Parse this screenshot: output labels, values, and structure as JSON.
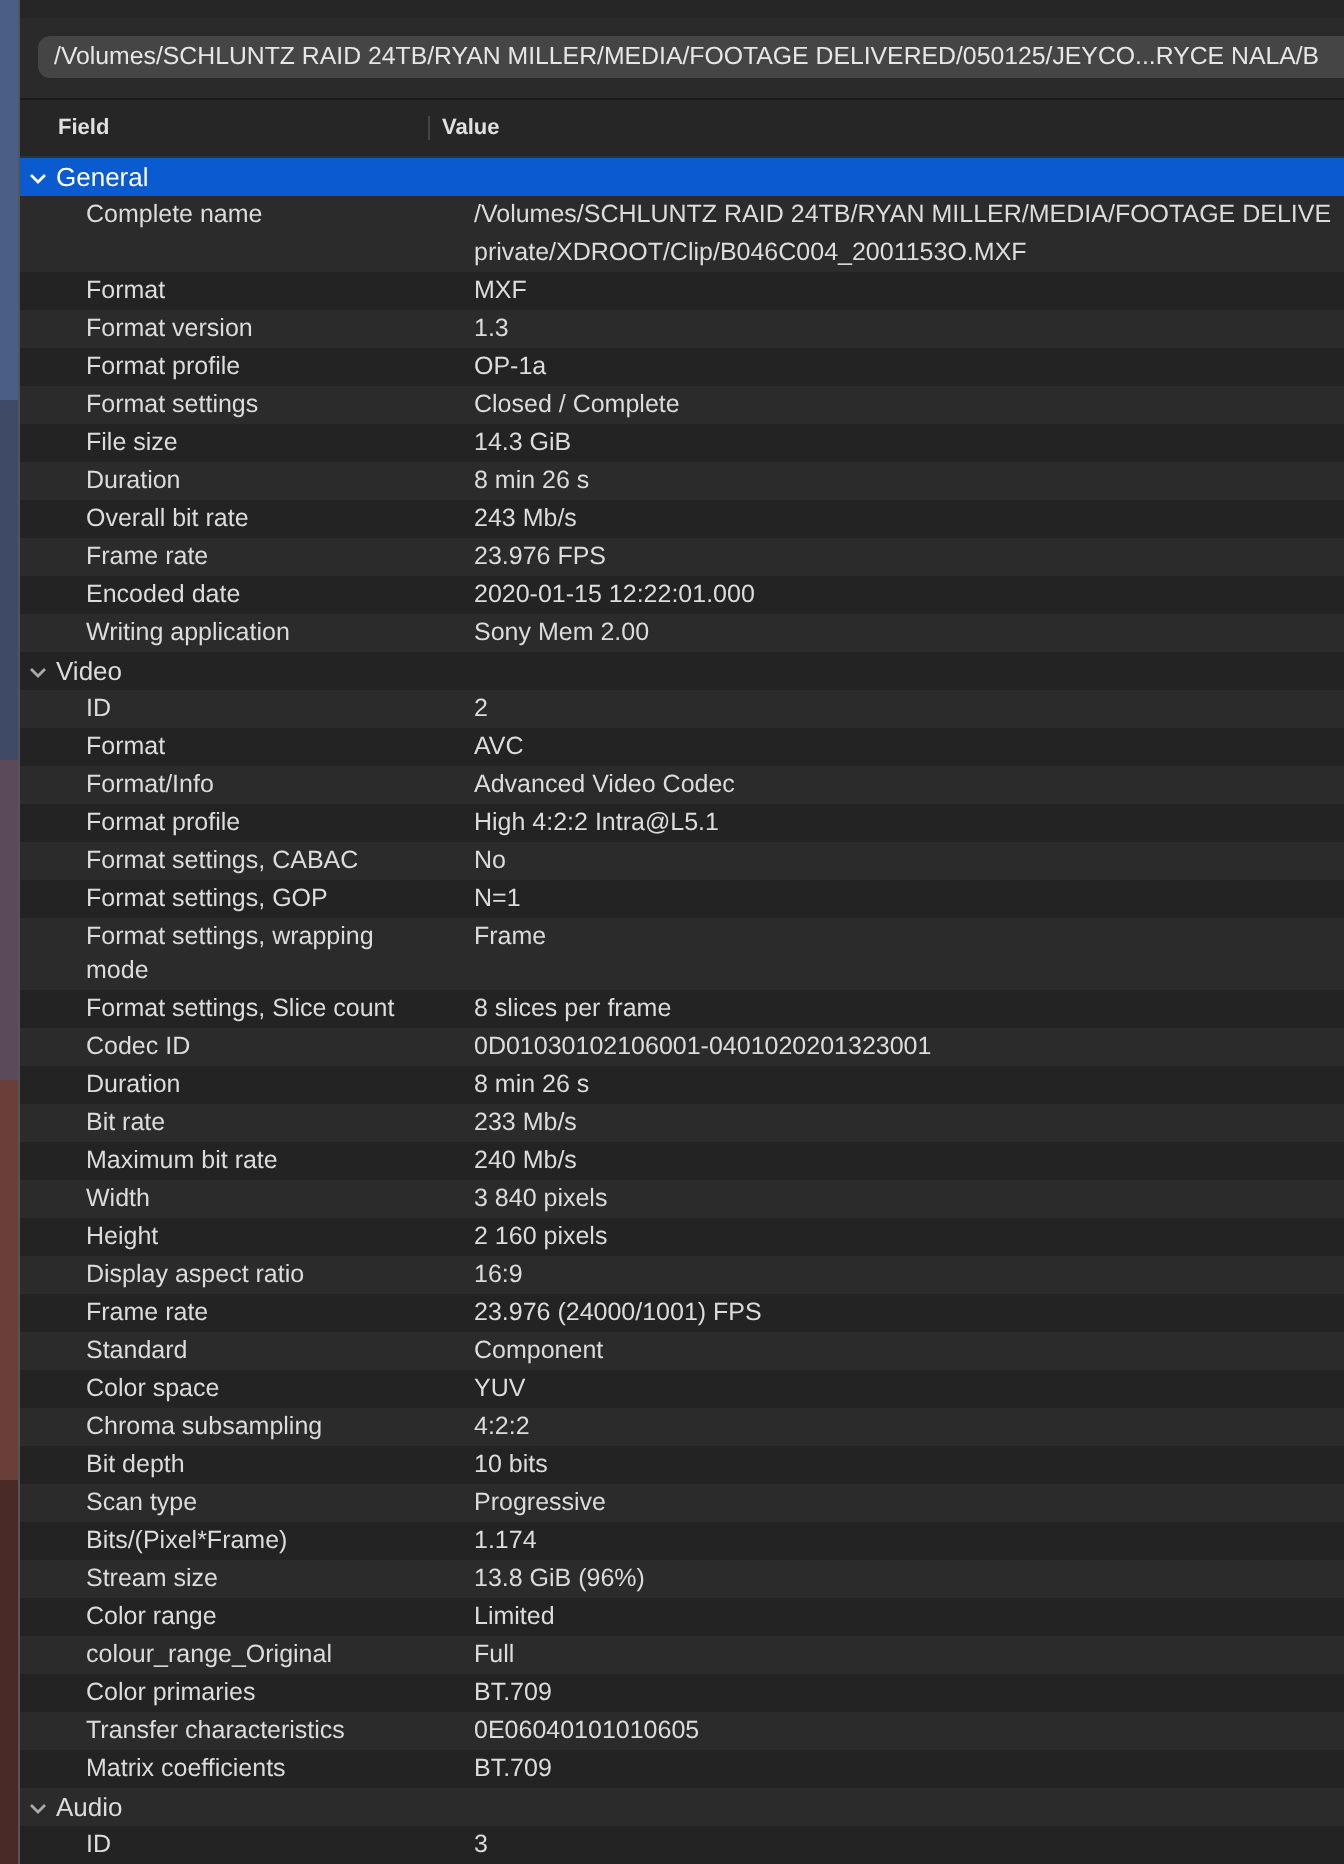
{
  "path_field": {
    "value": "/Volumes/SCHLUNTZ RAID 24TB/RYAN MILLER/MEDIA/FOOTAGE DELIVERED/050125/JEYCO...RYCE NALA/B"
  },
  "table": {
    "columns": [
      "Field",
      "Value"
    ],
    "sections": [
      {
        "name": "General",
        "expanded": true,
        "selected": true,
        "rows": [
          {
            "field": "Complete name",
            "value_lines": [
              "/Volumes/SCHLUNTZ RAID 24TB/RYAN MILLER/MEDIA/FOOTAGE DELIVE",
              "private/XDROOT/Clip/B046C004_2001153O.MXF"
            ]
          },
          {
            "field": "Format",
            "value": "MXF"
          },
          {
            "field": "Format version",
            "value": "1.3"
          },
          {
            "field": "Format profile",
            "value": "OP-1a"
          },
          {
            "field": "Format settings",
            "value": "Closed / Complete"
          },
          {
            "field": "File size",
            "value": "14.3 GiB"
          },
          {
            "field": "Duration",
            "value": "8 min 26 s"
          },
          {
            "field": "Overall bit rate",
            "value": "243 Mb/s"
          },
          {
            "field": "Frame rate",
            "value": "23.976 FPS"
          },
          {
            "field": "Encoded date",
            "value": "2020-01-15 12:22:01.000"
          },
          {
            "field": "Writing application",
            "value": "Sony Mem 2.00"
          }
        ]
      },
      {
        "name": "Video",
        "expanded": true,
        "selected": false,
        "rows": [
          {
            "field": "ID",
            "value": "2"
          },
          {
            "field": "Format",
            "value": "AVC"
          },
          {
            "field": "Format/Info",
            "value": "Advanced Video Codec"
          },
          {
            "field": "Format profile",
            "value": "High 4:2:2 Intra@L5.1"
          },
          {
            "field": "Format settings, CABAC",
            "value": "No"
          },
          {
            "field": "Format settings, GOP",
            "value": "N=1"
          },
          {
            "field": "Format settings, wrapping mode",
            "value": "Frame"
          },
          {
            "field": "Format settings, Slice count",
            "value": "8 slices per frame"
          },
          {
            "field": "Codec ID",
            "value": "0D01030102106001-0401020201323001"
          },
          {
            "field": "Duration",
            "value": "8 min 26 s"
          },
          {
            "field": "Bit rate",
            "value": "233 Mb/s"
          },
          {
            "field": "Maximum bit rate",
            "value": "240 Mb/s"
          },
          {
            "field": "Width",
            "value": "3 840 pixels"
          },
          {
            "field": "Height",
            "value": "2 160 pixels"
          },
          {
            "field": "Display aspect ratio",
            "value": "16:9"
          },
          {
            "field": "Frame rate",
            "value": "23.976 (24000/1001) FPS"
          },
          {
            "field": "Standard",
            "value": "Component"
          },
          {
            "field": "Color space",
            "value": "YUV"
          },
          {
            "field": "Chroma subsampling",
            "value": "4:2:2"
          },
          {
            "field": "Bit depth",
            "value": "10 bits"
          },
          {
            "field": "Scan type",
            "value": "Progressive"
          },
          {
            "field": "Bits/(Pixel*Frame)",
            "value": "1.174"
          },
          {
            "field": "Stream size",
            "value": "13.8 GiB (96%)"
          },
          {
            "field": "Color range",
            "value": "Limited"
          },
          {
            "field": "colour_range_Original",
            "value": "Full"
          },
          {
            "field": "Color primaries",
            "value": "BT.709"
          },
          {
            "field": "Transfer characteristics",
            "value": "0E06040101010605"
          },
          {
            "field": "Matrix coefficients",
            "value": "BT.709"
          }
        ]
      },
      {
        "name": "Audio",
        "expanded": true,
        "selected": false,
        "rows": [
          {
            "field": "ID",
            "value": "3"
          }
        ]
      }
    ]
  }
}
